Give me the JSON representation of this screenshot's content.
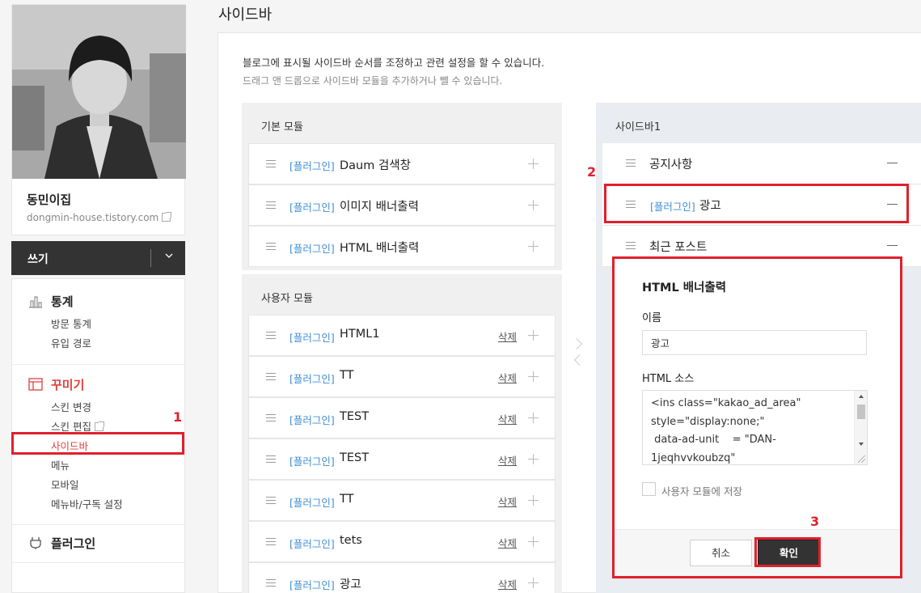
{
  "profile": {
    "blog_name": "동민이집",
    "url": "dongmin-house.tistory.com"
  },
  "write": {
    "label": "쓰기"
  },
  "menu": {
    "stats": {
      "title": "통계",
      "items": [
        "방문 통계",
        "유입 경로"
      ]
    },
    "decorate": {
      "title": "꾸미기",
      "items": [
        "스킨 변경",
        "스킨 편집",
        "사이드바",
        "메뉴",
        "모바일",
        "메뉴바/구독 설정"
      ]
    },
    "plugin": {
      "title": "플러그인"
    }
  },
  "page": {
    "title": "사이드바",
    "desc1": "블로그에 표시될 사이드바 순서를 조정하고 관련 설정을 할 수 있습니다.",
    "desc2": "드래그 앤 드롭으로 사이드바 모듈을 추가하거나 뺄 수 있습니다."
  },
  "basic_modules": {
    "title": "기본 모듈",
    "items": [
      {
        "tag": "[플러그인]",
        "name": "Daum 검색창"
      },
      {
        "tag": "[플러그인]",
        "name": "이미지 배너출력"
      },
      {
        "tag": "[플러그인]",
        "name": "HTML 배너출력"
      }
    ]
  },
  "user_modules": {
    "title": "사용자 모듈",
    "delete_label": "삭제",
    "items": [
      {
        "tag": "[플러그인]",
        "name": "HTML1"
      },
      {
        "tag": "[플러그인]",
        "name": "TT"
      },
      {
        "tag": "[플러그인]",
        "name": "TEST"
      },
      {
        "tag": "[플러그인]",
        "name": "TEST"
      },
      {
        "tag": "[플러그인]",
        "name": "TT"
      },
      {
        "tag": "[플러그인]",
        "name": "tets"
      },
      {
        "tag": "[플러그인]",
        "name": "광고"
      }
    ]
  },
  "sidebar1": {
    "title": "사이드바1",
    "items": [
      {
        "tag": "",
        "name": "공지사항"
      },
      {
        "tag": "[플러그인]",
        "name": "광고"
      },
      {
        "tag": "",
        "name": "최근 포스트"
      }
    ]
  },
  "modal": {
    "title": "HTML 배너출력",
    "name_label": "이름",
    "name_value": "광고",
    "source_label": "HTML 소스",
    "source_value": "<ins class=\"kakao_ad_area\"\nstyle=\"display:none;\"\n data-ad-unit    = \"DAN-\n1jeqhvvkoubzq\"",
    "save_checkbox_label": "사용자 모듈에 저장",
    "cancel_label": "취소",
    "ok_label": "확인"
  },
  "annotations": {
    "step1": "1",
    "step2": "2",
    "step3": "3"
  },
  "colors": {
    "highlight": "#e0202c",
    "active_menu": "#e33e3e",
    "plugin_tag": "#3c8ed6"
  }
}
